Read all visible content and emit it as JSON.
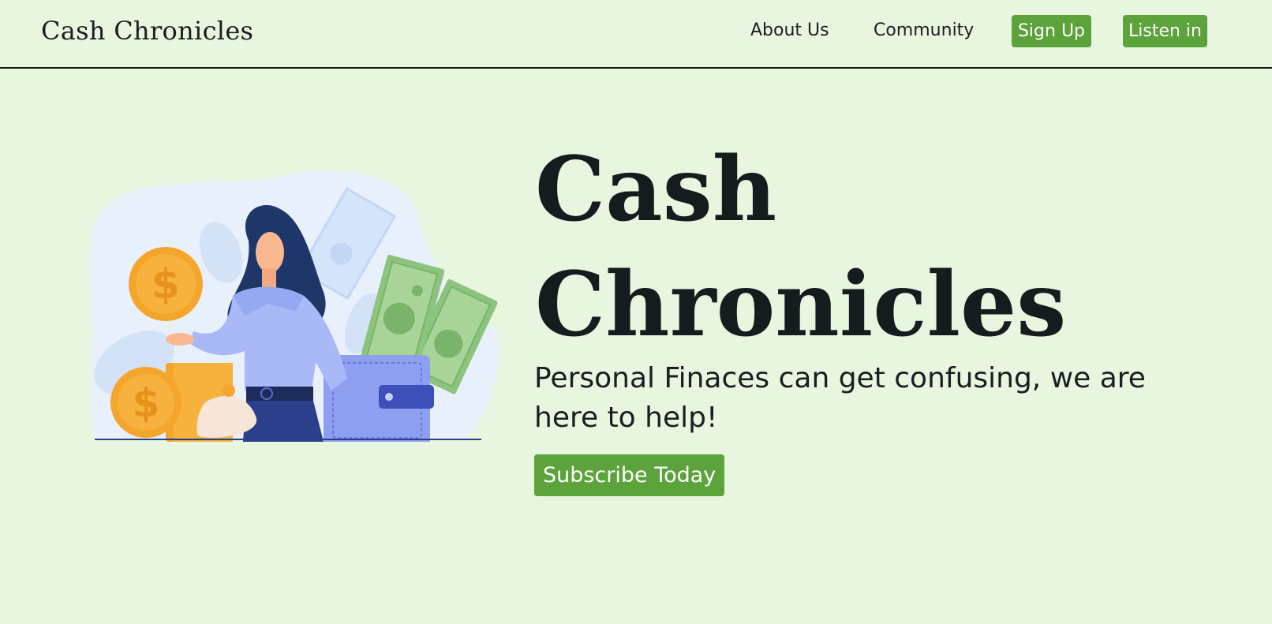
{
  "nav": {
    "brand": "Cash Chronicles",
    "links": [
      {
        "label": "About Us"
      },
      {
        "label": "Community"
      }
    ],
    "buttons": [
      {
        "label": "Sign Up"
      },
      {
        "label": "Listen in"
      }
    ]
  },
  "hero": {
    "title_line1": "Cash",
    "title_line2": "Chronicles",
    "subtitle": "Personal Finaces can get confusing, we are here to help!",
    "cta_label": "Subscribe Today",
    "illustration": {
      "coin_symbol": "$",
      "icon": "woman-with-money-illustration"
    }
  },
  "colors": {
    "background": "#e8f6df",
    "accent": "#5ba33a",
    "text": "#1a1e21"
  }
}
